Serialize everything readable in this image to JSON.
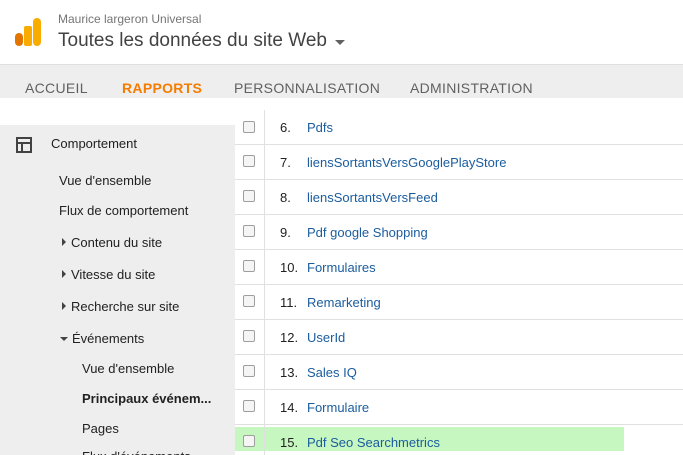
{
  "header": {
    "account": "Maurice largeron Universal",
    "property": "Toutes les données du site Web"
  },
  "nav": {
    "tabs": [
      "ACCUEIL",
      "RAPPORTS",
      "PERSONNALISATION",
      "ADMINISTRATION"
    ],
    "active": "RAPPORTS",
    "accent_color": "#f57c00"
  },
  "sidebar": {
    "section": "Comportement",
    "items": [
      "Vue d'ensemble",
      "Flux de comportement",
      "Contenu du site",
      "Vitesse du site",
      "Recherche sur site",
      "Événements",
      "Vue d'ensemble",
      "Principaux événem...",
      "Pages",
      "Flux d'événements"
    ]
  },
  "table": {
    "rows": [
      {
        "num": "6.",
        "label": "Pdfs"
      },
      {
        "num": "7.",
        "label": "liensSortantsVersGooglePlayStore"
      },
      {
        "num": "8.",
        "label": "liensSortantsVersFeed"
      },
      {
        "num": "9.",
        "label": "Pdf google Shopping"
      },
      {
        "num": "10.",
        "label": "Formulaires"
      },
      {
        "num": "11.",
        "label": "Remarketing"
      },
      {
        "num": "12.",
        "label": "UserId"
      },
      {
        "num": "13.",
        "label": "Sales IQ"
      },
      {
        "num": "14.",
        "label": "Formulaire"
      },
      {
        "num": "15.",
        "label": "Pdf Seo Searchmetrics"
      }
    ],
    "highlight_color": "#c6f7c0",
    "link_color": "#1a5c9e"
  }
}
